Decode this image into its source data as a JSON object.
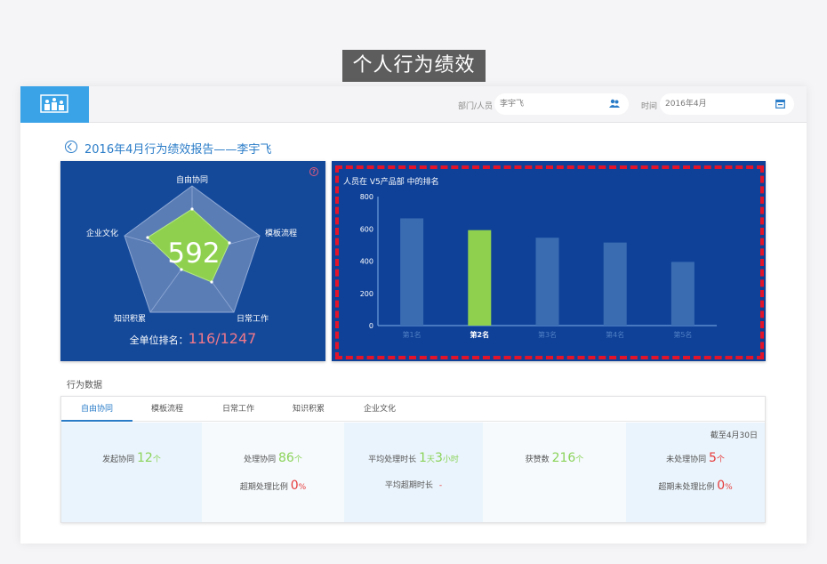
{
  "banner": "个人行为绩效",
  "header": {
    "dept_label": "部门/人员",
    "dept_value": "李宇飞",
    "time_label": "时间",
    "time_value": "2016年4月"
  },
  "page_title": "2016年4月行为绩效报告——李宇飞",
  "radar": {
    "labels": [
      "自由协同",
      "模板流程",
      "日常工作",
      "知识积累",
      "企业文化"
    ],
    "score": "592",
    "rank_label": "全单位排名：",
    "rank_value": "116/1247",
    "help": "?"
  },
  "chart_data": {
    "type": "bar",
    "title": "人员在 V5产品部 中的排名",
    "categories": [
      "第1名",
      "第2名",
      "第3名",
      "第4名",
      "第5名"
    ],
    "values": [
      665,
      592,
      545,
      515,
      395
    ],
    "highlight_index": 1,
    "yticks": [
      0,
      200,
      400,
      600,
      800
    ],
    "ylim": [
      0,
      800
    ],
    "colors": {
      "bar": "#3a6cb2",
      "highlight": "#8fd14f",
      "axis": "#7fb0e8"
    }
  },
  "section_title": "行为数据",
  "tabs": [
    "自由协同",
    "模板流程",
    "日常工作",
    "知识积累",
    "企业文化"
  ],
  "as_of": "截至4月30日",
  "stats": {
    "s1": {
      "label": "发起协同",
      "value": "12",
      "unit": "个"
    },
    "s2": {
      "label": "处理协同",
      "value": "86",
      "unit": "个",
      "label2": "超期处理比例",
      "value2": "0",
      "unit2": "%"
    },
    "s3": {
      "label": "平均处理时长",
      "v1": "1",
      "u1": "天",
      "v2": "3",
      "u2": "小时",
      "label2": "平均超期时长",
      "value2": "-"
    },
    "s4": {
      "label": "获赞数",
      "value": "216",
      "unit": "个"
    },
    "s5": {
      "label": "未处理协同",
      "value": "5",
      "unit": "个",
      "label2": "超期未处理比例",
      "value2": "0",
      "unit2": "%"
    }
  }
}
